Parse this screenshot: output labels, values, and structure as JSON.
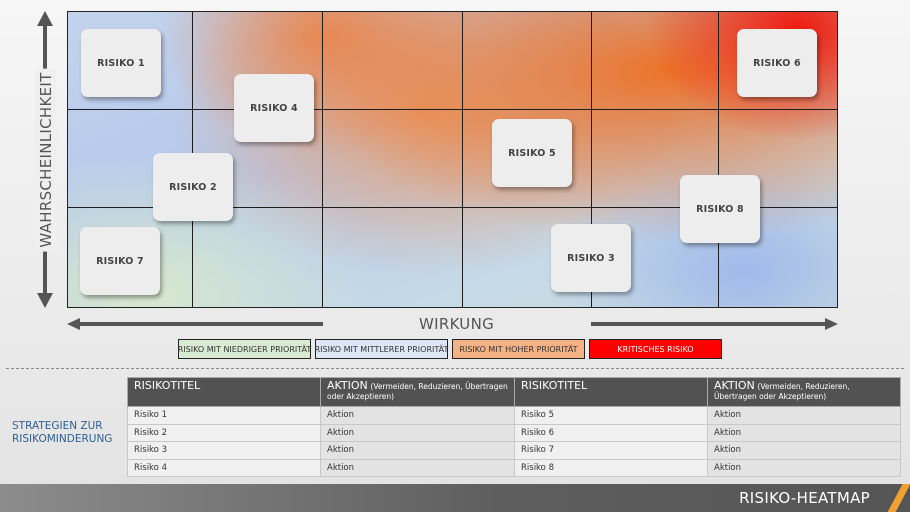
{
  "heatmap": {
    "y_axis_label": "WAHRSCHEINLICHKEIT",
    "x_axis_label": "WIRKUNG",
    "risks": [
      {
        "label": "RISIKO 1"
      },
      {
        "label": "RISIKO 2"
      },
      {
        "label": "RISIKO 3"
      },
      {
        "label": "RISIKO 4"
      },
      {
        "label": "RISIKO 5"
      },
      {
        "label": "RISIKO 6"
      },
      {
        "label": "RISIKO 7"
      },
      {
        "label": "RISIKO 8"
      }
    ]
  },
  "legend": [
    {
      "label": "RISIKO MIT NIEDRIGER PRIORITÄT",
      "color": "#d9ead3",
      "text_color": "#333333"
    },
    {
      "label": "RISIKO MIT MITTLERER PRIORITÄT",
      "color": "#dce6f4",
      "text_color": "#333333"
    },
    {
      "label": "RISIKO MIT HOHER PRIORITÄT",
      "color": "#f4b183",
      "text_color": "#333333"
    },
    {
      "label": "KRITISCHES RISIKO",
      "color": "#ff0000",
      "text_color": "#ffffff"
    }
  ],
  "strategy": {
    "label_line1": "STRATEGIEN ZUR",
    "label_line2": "RISIKOMINDERUNG"
  },
  "table": {
    "headers": [
      {
        "main": "RISIKOTITEL",
        "sub": ""
      },
      {
        "main": "AKTION",
        "sub": "(Vermeiden, Reduzieren, Übertragen oder Akzeptieren)"
      },
      {
        "main": "RISIKOTITEL",
        "sub": ""
      },
      {
        "main": "AKTION",
        "sub": "(Vermeiden, Reduzieren, Übertragen oder Akzeptieren)"
      }
    ],
    "rows": [
      [
        "Risiko 1",
        "Aktion",
        "Risiko 5",
        "Aktion"
      ],
      [
        "Risiko 2",
        "Aktion",
        "Risiko 6",
        "Aktion"
      ],
      [
        "Risiko 3",
        "Aktion",
        "Risiko 7",
        "Aktion"
      ],
      [
        "Risiko 4",
        "Aktion",
        "Risiko 8",
        "Aktion"
      ]
    ]
  },
  "footer": {
    "title": "RISIKO-HEATMAP",
    "accent_color": "#f0a030"
  }
}
